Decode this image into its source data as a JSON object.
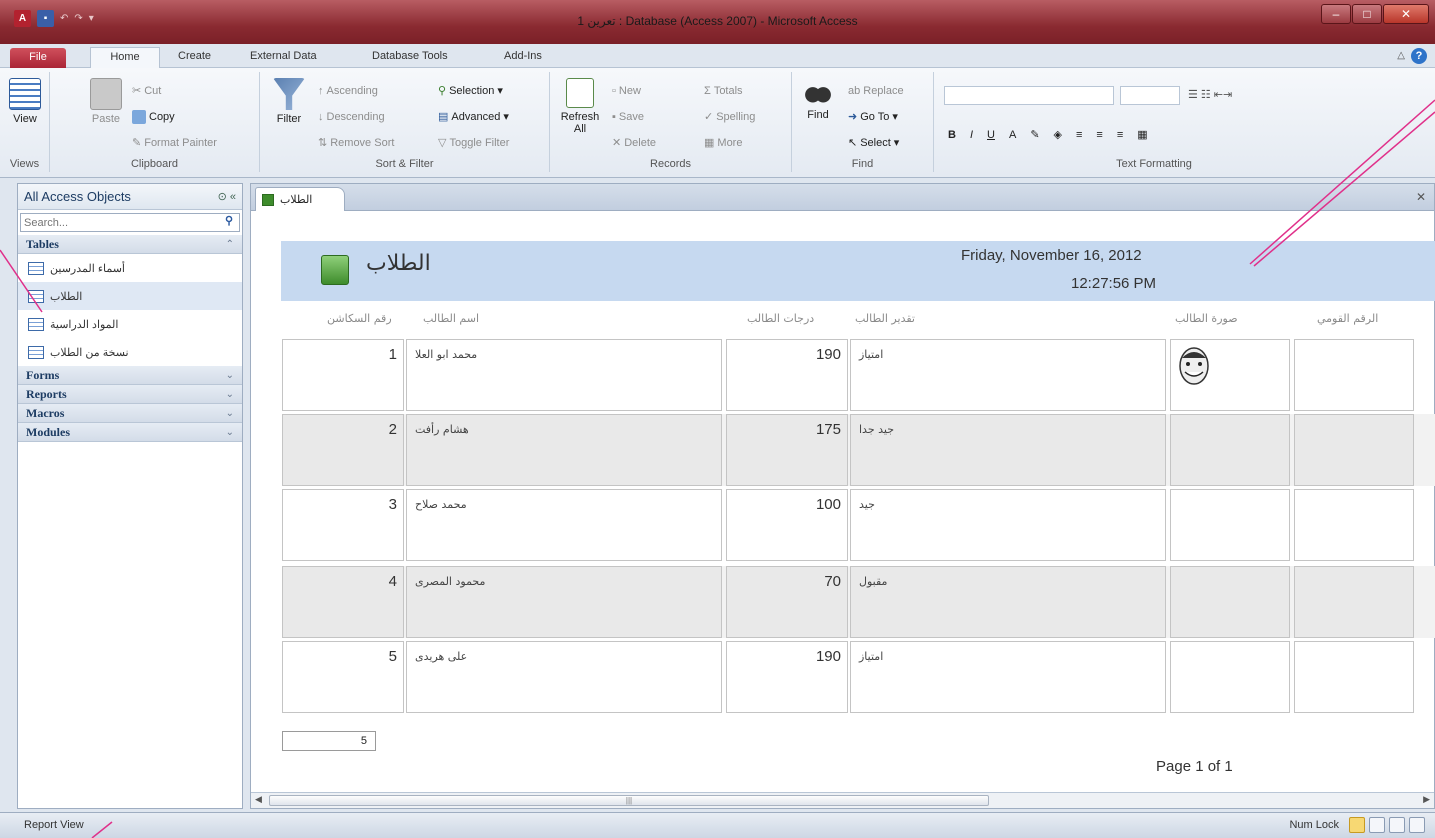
{
  "window": {
    "title": "تعرين 1 : Database (Access 2007)  -  Microsoft Access",
    "app_icon": "A",
    "controls": [
      "minimize",
      "maximize",
      "close"
    ]
  },
  "tabs": {
    "file": "File",
    "items": [
      "Home",
      "Create",
      "External Data",
      "Database Tools",
      "Add-Ins"
    ]
  },
  "ribbon": {
    "views": {
      "view": "View",
      "label": "Views"
    },
    "clipboard": {
      "paste": "Paste",
      "cut": "Cut",
      "copy": "Copy",
      "format_painter": "Format Painter",
      "label": "Clipboard"
    },
    "sort_filter": {
      "filter": "Filter",
      "ascending": "Ascending",
      "descending": "Descending",
      "remove_sort": "Remove Sort",
      "selection": "Selection",
      "advanced": "Advanced",
      "toggle_filter": "Toggle Filter",
      "label": "Sort & Filter"
    },
    "records": {
      "refresh": "Refresh",
      "refresh_all": "All",
      "new": "New",
      "save": "Save",
      "delete": "Delete",
      "totals": "Totals",
      "spelling": "Spelling",
      "more": "More",
      "label": "Records"
    },
    "find": {
      "find": "Find",
      "replace": "Replace",
      "goto": "Go To",
      "select": "Select",
      "label": "Find"
    },
    "text_formatting": {
      "label": "Text Formatting",
      "bold": "B",
      "italic": "I",
      "underline": "U",
      "font_color": "A"
    }
  },
  "navpane": {
    "header": "All Access Objects",
    "search_placeholder": "Search...",
    "categories": [
      {
        "label": "Tables",
        "items": [
          "أسماء المدرسين",
          "الطلاب",
          "المواد الدراسية",
          "نسخة من الطلاب"
        ]
      },
      {
        "label": "Forms"
      },
      {
        "label": "Reports"
      },
      {
        "label": "Macros"
      },
      {
        "label": "Modules"
      }
    ]
  },
  "document": {
    "tab": "الطلاب",
    "report": {
      "title": "الطلاب",
      "date": "Friday, November 16, 2012",
      "time": "12:27:56 PM",
      "columns": [
        "رقم السكاشن",
        "اسم الطالب",
        "درجات الطالب",
        "تقدير الطالب",
        "صورة الطالب",
        "الرقم القومي"
      ],
      "rows": [
        {
          "id": "1",
          "name": "محمد ابو العلا",
          "score": "190",
          "grade": "امتياز"
        },
        {
          "id": "2",
          "name": "هشام رأفت",
          "score": "175",
          "grade": "جيد جدا"
        },
        {
          "id": "3",
          "name": "محمد صلاح",
          "score": "100",
          "grade": "جيد"
        },
        {
          "id": "4",
          "name": "محمود المصرى",
          "score": "70",
          "grade": "مقبول"
        },
        {
          "id": "5",
          "name": "على هريدى",
          "score": "190",
          "grade": "امتياز"
        }
      ],
      "count": "5",
      "page": "Page 1 of 1"
    }
  },
  "status": {
    "left": "Report View",
    "right": "Num Lock"
  },
  "colors": {
    "titlebar": "#8a2a31",
    "header_band": "#c6d9f0",
    "annotation": "#e0308a"
  }
}
